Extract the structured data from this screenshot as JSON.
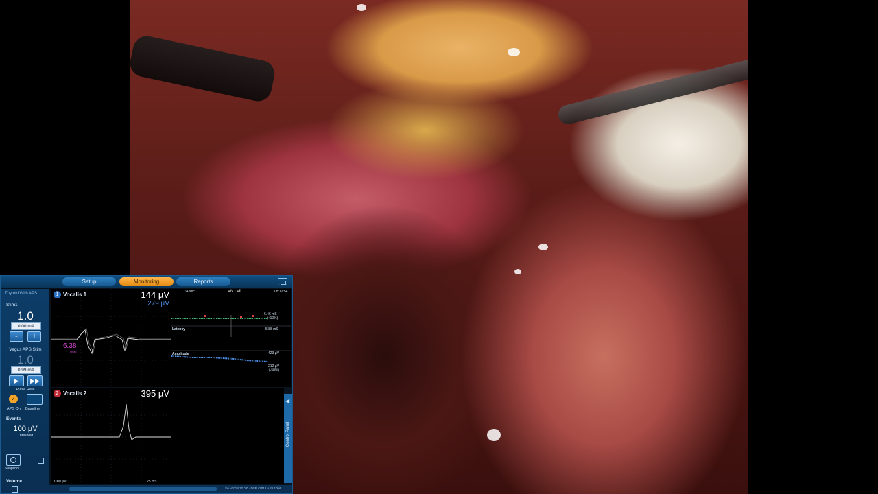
{
  "app": {
    "mode_label": "Thyroid With APS"
  },
  "tabs": [
    {
      "label": "Setup"
    },
    {
      "label": "Monitoring"
    },
    {
      "label": "Reports"
    }
  ],
  "stim1": {
    "label": "Stim1",
    "value": "1.0",
    "current": "0.00 mA",
    "minus": "-",
    "plus": "+"
  },
  "vagus": {
    "label": "Vagus APS Stim",
    "value": "1.0",
    "current": "0.99 mA",
    "pulse_rate_label": "Pulse Rate",
    "aps_on_label": "APS On",
    "baseline_label": "Baseline"
  },
  "events": {
    "label": "Events",
    "threshold_value": "100 µV",
    "threshold_label": "Threshold",
    "snapshot_label": "Snapshot"
  },
  "volume": {
    "label": "Volume",
    "value": "45",
    "level": 0.45
  },
  "channels": [
    {
      "number": "1",
      "name": "Vocalis 1",
      "amplitude": "144 µV",
      "secondary": "279 µV",
      "latency": "6.38",
      "latency_unit": "msec"
    },
    {
      "number": "2",
      "name": "Vocalis 2",
      "amplitude": "395 µV"
    }
  ],
  "scale": {
    "left": "1000 µV",
    "right": "25 mS"
  },
  "trend": {
    "window": "64 sec",
    "title": "VN Left",
    "time": "08:12:54",
    "latency_label": "Latency",
    "latency_value1": "6.46 mS",
    "latency_value1_pct": "(+10%)",
    "latency_value2": "5.88 mS",
    "amplitude_label": "Amplitude",
    "amplitude_value1": "423 µV",
    "amplitude_value2": "212 µV",
    "amplitude_pct": "(-50%)"
  },
  "control_panel": {
    "label": "Control Panel"
  },
  "footer": {
    "version": "Sw v2018.12.0.0 · DSP v2018.6.26 10bit"
  },
  "colors": {
    "accent_orange": "#e38a12",
    "panel_blue": "#0c3d68",
    "trace_green": "#3fb56a",
    "trace_blue": "#4c8de3",
    "latency_magenta": "#d44ad0"
  }
}
